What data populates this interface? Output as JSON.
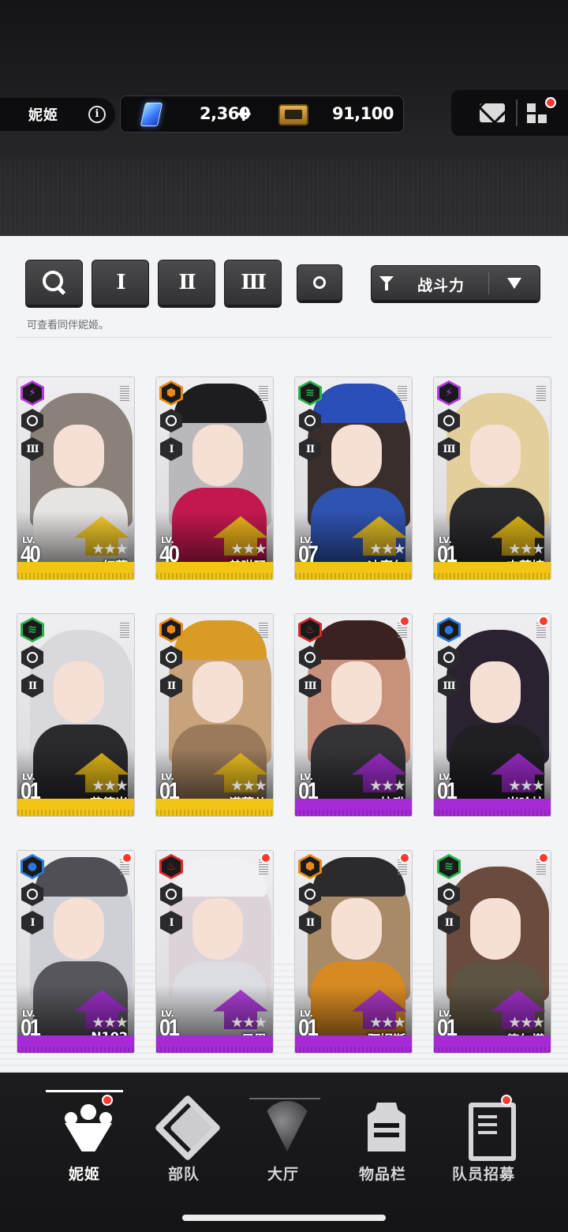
{
  "header": {
    "section_label": "妮姬",
    "gems_value": "2,360",
    "gems_add": "+",
    "credits_value": "91,100"
  },
  "filters": {
    "burst_buttons": [
      "I",
      "II",
      "III"
    ],
    "sort_label": "战斗力",
    "hint": "可查看同伴妮姬。"
  },
  "characters": [
    {
      "name": "红莲",
      "level": "40",
      "burst": "III",
      "element": "electric",
      "element_color": "#b53be0",
      "rarity": "SSR",
      "rarity_color": "#f2c416",
      "notify": false
    },
    {
      "name": "普琳玛",
      "level": "40",
      "burst": "I",
      "element": "iron",
      "element_color": "#e98a14",
      "rarity": "SSR",
      "rarity_color": "#f2c416",
      "notify": false
    },
    {
      "name": "迪塞尔",
      "level": "07",
      "burst": "II",
      "element": "wind",
      "element_color": "#27b34a",
      "rarity": "SSR",
      "rarity_color": "#f2c416",
      "notify": false
    },
    {
      "name": "吉萝婷",
      "level": "01",
      "burst": "III",
      "element": "electric",
      "element_color": "#b53be0",
      "rarity": "SSR",
      "rarity_color": "#f2c416",
      "notify": false
    },
    {
      "name": "艾德米",
      "level": "01",
      "burst": "II",
      "element": "wind",
      "element_color": "#27b34a",
      "rarity": "SSR",
      "rarity_color": "#f2c416",
      "notify": false
    },
    {
      "name": "诺薇儿",
      "level": "01",
      "burst": "II",
      "element": "iron",
      "element_color": "#e98a14",
      "rarity": "SSR",
      "rarity_color": "#f2c416",
      "notify": false
    },
    {
      "name": "拉毗",
      "level": "01",
      "burst": "III",
      "element": "fire",
      "element_color": "#d8292b",
      "rarity": "SR",
      "rarity_color": "#a62bd6",
      "notify": true
    },
    {
      "name": "米哈拉",
      "level": "01",
      "burst": "III",
      "element": "water",
      "element_color": "#2a78d9",
      "rarity": "SR",
      "rarity_color": "#a62bd6",
      "notify": true
    },
    {
      "name": "N102",
      "level": "01",
      "burst": "I",
      "element": "water",
      "element_color": "#2a78d9",
      "rarity": "SR",
      "rarity_color": "#a62bd6",
      "notify": true
    },
    {
      "name": "尼恩",
      "level": "01",
      "burst": "I",
      "element": "fire",
      "element_color": "#d8292b",
      "rarity": "SR",
      "rarity_color": "#a62bd6",
      "notify": true
    },
    {
      "name": "阿妮斯",
      "level": "01",
      "burst": "II",
      "element": "iron",
      "element_color": "#e98a14",
      "rarity": "SR",
      "rarity_color": "#a62bd6",
      "notify": true
    },
    {
      "name": "德尔塔",
      "level": "01",
      "burst": "II",
      "element": "wind",
      "element_color": "#27b34a",
      "rarity": "SR",
      "rarity_color": "#a62bd6",
      "notify": true
    }
  ],
  "level_prefix": "LV.",
  "nav": [
    {
      "label": "妮姬",
      "icon": "people-icon",
      "active": true,
      "notify": true
    },
    {
      "label": "部队",
      "icon": "squad-icon",
      "active": false,
      "notify": false
    },
    {
      "label": "大厅",
      "icon": "lobby-icon",
      "active": false,
      "notify": false
    },
    {
      "label": "物品栏",
      "icon": "inventory-icon",
      "active": false,
      "notify": false
    },
    {
      "label": "队员招募",
      "icon": "recruit-icon",
      "active": false,
      "notify": true
    }
  ],
  "colors": {
    "ssr": "#f2c416",
    "sr": "#a62bd6",
    "notify": "#ff3b2f"
  }
}
